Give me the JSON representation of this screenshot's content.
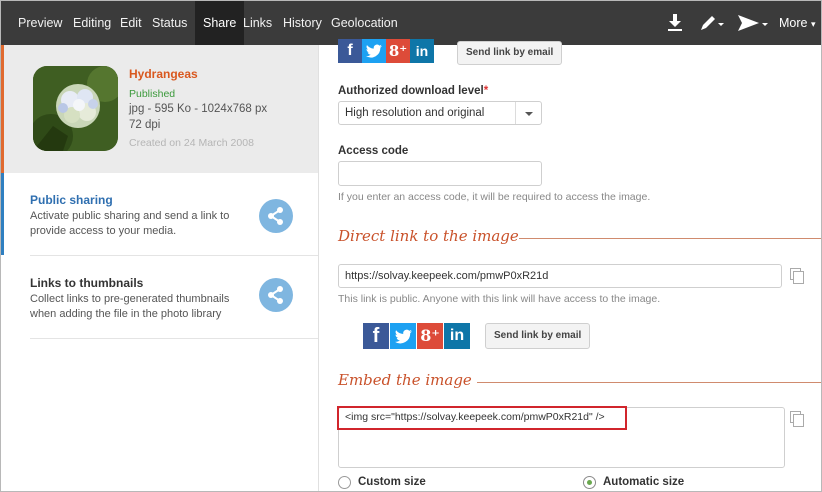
{
  "nav": {
    "tabs": [
      {
        "label": "Preview"
      },
      {
        "label": "Editing"
      },
      {
        "label": "Edit"
      },
      {
        "label": "Status"
      },
      {
        "label": "Share",
        "active": true
      },
      {
        "label": "Links"
      },
      {
        "label": "History"
      },
      {
        "label": "Geolocation"
      }
    ],
    "icons": [
      "download-icon",
      "pen-icon",
      "send-icon"
    ],
    "more_label": "More"
  },
  "file": {
    "title": "Hydrangeas",
    "status": "Published",
    "meta": "jpg - 595 Ko - 1024x768 px",
    "dpi": "72 dpi",
    "created": "Created on 24 March 2008"
  },
  "sidebar": {
    "items": [
      {
        "title": "Public sharing",
        "description": "Activate public sharing and send a link to provide access to your media.",
        "active": true
      },
      {
        "title": "Links to thumbnails",
        "description": "Collect links to pre-generated thumbnails when adding the file in the photo library",
        "active": false
      }
    ]
  },
  "main": {
    "send_email_label": "Send link by email",
    "download_level_label": "Authorized download level",
    "download_level_required": "*",
    "download_level_value": "High resolution and original",
    "access_code_label": "Access code",
    "access_code_value": "",
    "access_code_hint": "If you enter an access code, it will be required to access the image.",
    "direct_link_title": "Direct link to the image",
    "direct_link_value": "https://solvay.keepeek.com/pmwP0xR21d",
    "direct_link_hint": "This link is public. Anyone with this link will have access to the image.",
    "embed_title": "Embed the image",
    "embed_code": "<img src=\"https://solvay.keepeek.com/pmwP0xR21d\" />",
    "size_options": [
      {
        "label": "Custom size",
        "selected": false
      },
      {
        "label": "Automatic size",
        "selected": true
      }
    ]
  },
  "colors": {
    "nav_bg": "#3b3b3b",
    "accent_orange": "#c9522b",
    "accent_blue": "#2f6fb0",
    "facebook": "#3b5998",
    "twitter": "#1da1f2",
    "googleplus": "#dd4b39",
    "linkedin": "#0e76a8",
    "highlight_red": "#d1252c"
  }
}
